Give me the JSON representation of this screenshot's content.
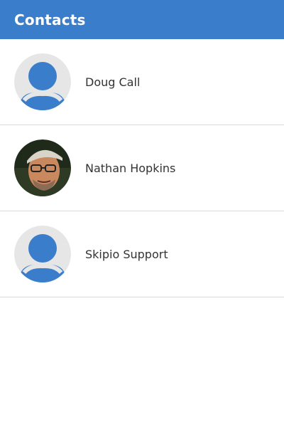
{
  "header": {
    "title": "Contacts"
  },
  "colors": {
    "header_bg": "#3a7ecb",
    "avatar_placeholder_bg": "#e6e6e6",
    "avatar_placeholder_fg": "#3a7ecb"
  },
  "contacts": [
    {
      "name": "Doug Call",
      "avatar": "default-avatar-icon"
    },
    {
      "name": "Nathan Hopkins",
      "avatar": "photo-avatar"
    },
    {
      "name": "Skipio Support",
      "avatar": "default-avatar-icon"
    }
  ]
}
